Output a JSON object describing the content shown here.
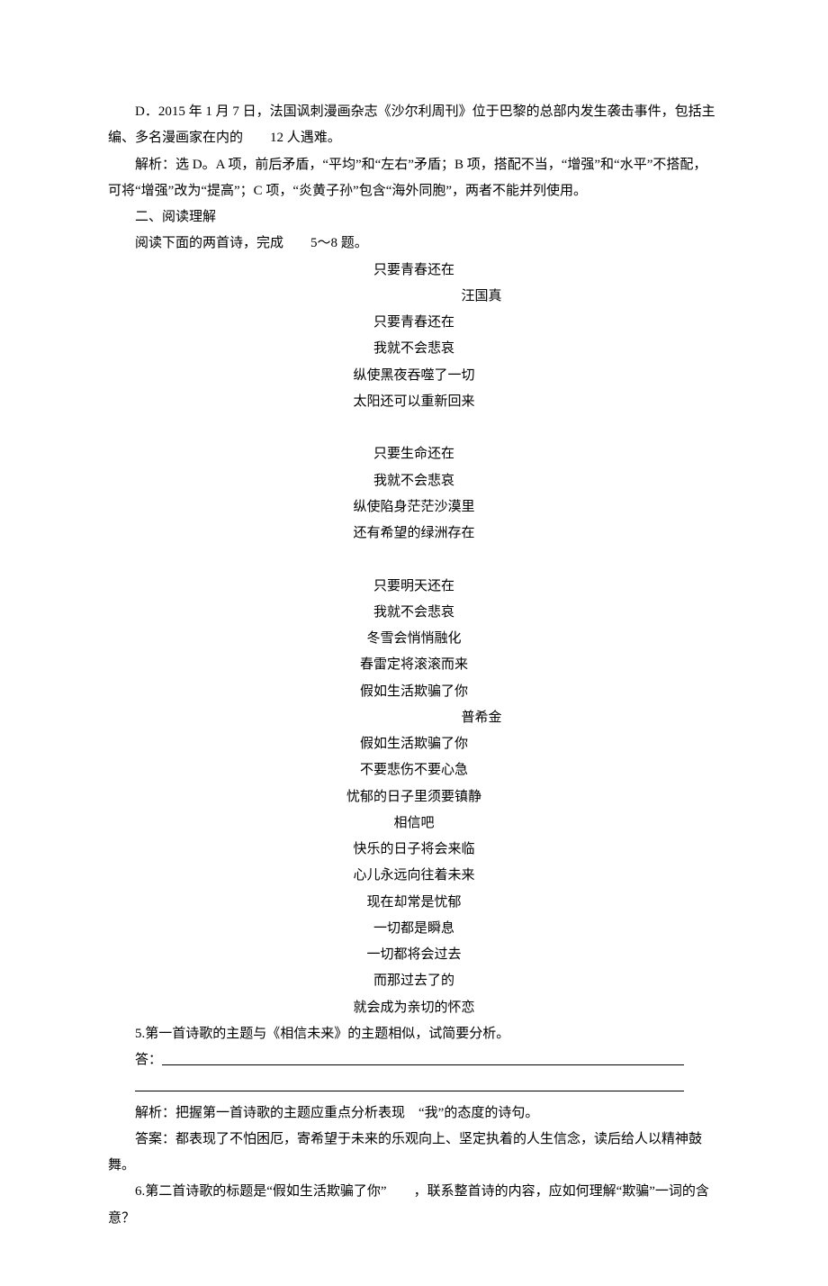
{
  "option_d": "D．2015 年 1 月 7 日，法国讽刺漫画杂志《沙尔利周刊》位于巴黎的总部内发生袭击事件，包括主编、多名漫画家在内的　　12 人遇难。",
  "analysis_d": "解析：选 D。A 项，前后矛盾，“平均”和“左右”矛盾；B 项，搭配不当，“增强”和“水平”不搭配，可将“增强”改为“提高”；C 项，“炎黄子孙”包含“海外同胞”，两者不能并列使用。",
  "section2_heading": "二、阅读理解",
  "read_instruction": "阅读下面的两首诗，完成　　5～8 题。",
  "poem1": {
    "title": "只要青春还在",
    "author": "汪国真",
    "stanzas": [
      [
        "只要青春还在",
        "我就不会悲哀",
        "纵使黑夜吞噬了一切",
        "太阳还可以重新回来"
      ],
      [
        "只要生命还在",
        "我就不会悲哀",
        "纵使陷身茫茫沙漠里",
        "还有希望的绿洲存在"
      ],
      [
        "只要明天还在",
        "我就不会悲哀",
        "冬雪会悄悄融化",
        "春雷定将滚滚而来"
      ]
    ]
  },
  "poem2": {
    "title": "假如生活欺骗了你",
    "author": "普希金",
    "lines": [
      "假如生活欺骗了你",
      "不要悲伤不要心急",
      "忧郁的日子里须要镇静",
      "相信吧",
      "快乐的日子将会来临",
      "心儿永远向往着未来",
      "现在却常是忧郁",
      "一切都是瞬息",
      "一切都将会过去",
      "而那过去了的",
      "就会成为亲切的怀恋"
    ]
  },
  "q5": {
    "question": "5.第一首诗歌的主题与《相信未来》的主题相似，试简要分析。",
    "answer_label": "答：",
    "analysis": "解析：把握第一首诗歌的主题应重点分析表现　“我”的态度的诗句。",
    "answer": "答案：都表现了不怕困厄，寄希望于未来的乐观向上、坚定执着的人生信念，读后给人以精神鼓舞。"
  },
  "q6": {
    "question": "6.第二首诗歌的标题是“假如生活欺骗了你”　　，联系整首诗的内容，应如何理解“欺骗”一词的含意？"
  }
}
